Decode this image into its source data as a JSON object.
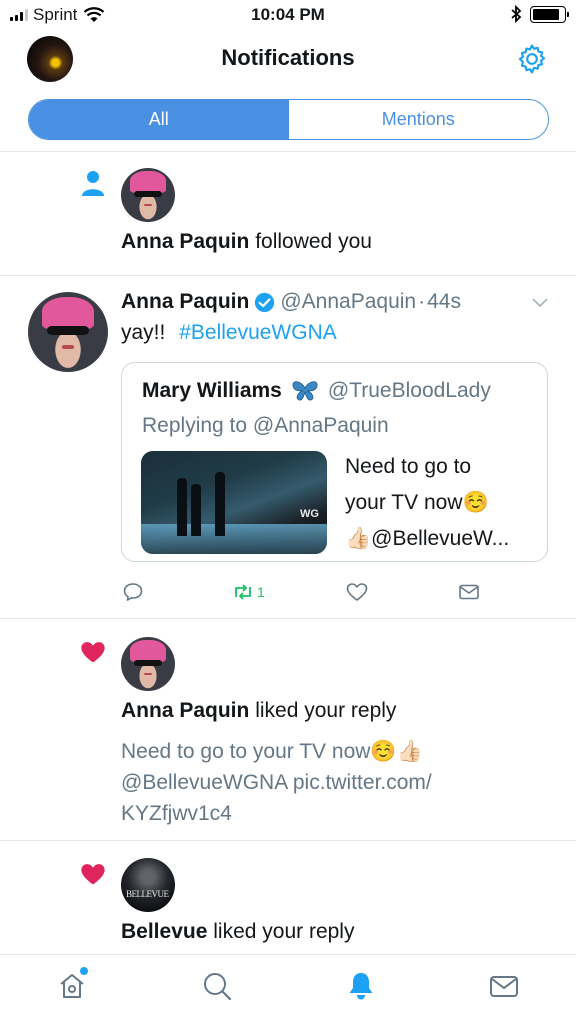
{
  "status_bar": {
    "carrier": "Sprint",
    "time": "10:04 PM",
    "battery_level": 0.85
  },
  "header": {
    "title": "Notifications"
  },
  "segmented": {
    "all_label": "All",
    "mentions_label": "Mentions",
    "selected": "All"
  },
  "notifications": [
    {
      "type": "follow",
      "user": "Anna Paquin",
      "action": "followed you"
    },
    {
      "type": "tweet",
      "name": "Anna Paquin",
      "handle": "@AnnaPaquin",
      "dot": "·",
      "time": "44s",
      "text": "yay!!",
      "hashtag": "#BellevueWGNA",
      "quote": {
        "name": "Mary Williams",
        "handle": "@TrueBloodLady",
        "replying": "Replying to @AnnaPaquin",
        "lines": [
          "Need to go to",
          "your TV now☺️",
          "👍🏻@BellevueW..."
        ],
        "media_logo": "WG"
      },
      "retweet_count": "1"
    },
    {
      "type": "like",
      "user": "Anna Paquin",
      "action": "liked your reply",
      "lines": [
        "Need to go to your TV now☺️👍🏻",
        "@BellevueWGNA pic.twitter.com/",
        "KYZfjwv1c4"
      ]
    },
    {
      "type": "like",
      "user": "Bellevue",
      "action": "liked your reply",
      "avatar_text": "BELLEVUE"
    }
  ],
  "colors": {
    "accent": "#4a90e2",
    "twitter_blue": "#1da1f2",
    "like": "#e0245e",
    "retweet": "#17bf63",
    "secondary": "#657786"
  },
  "tabbar": {
    "icons": [
      "home-icon",
      "search-icon",
      "bell-icon",
      "mail-icon"
    ],
    "active": "bell-icon"
  }
}
